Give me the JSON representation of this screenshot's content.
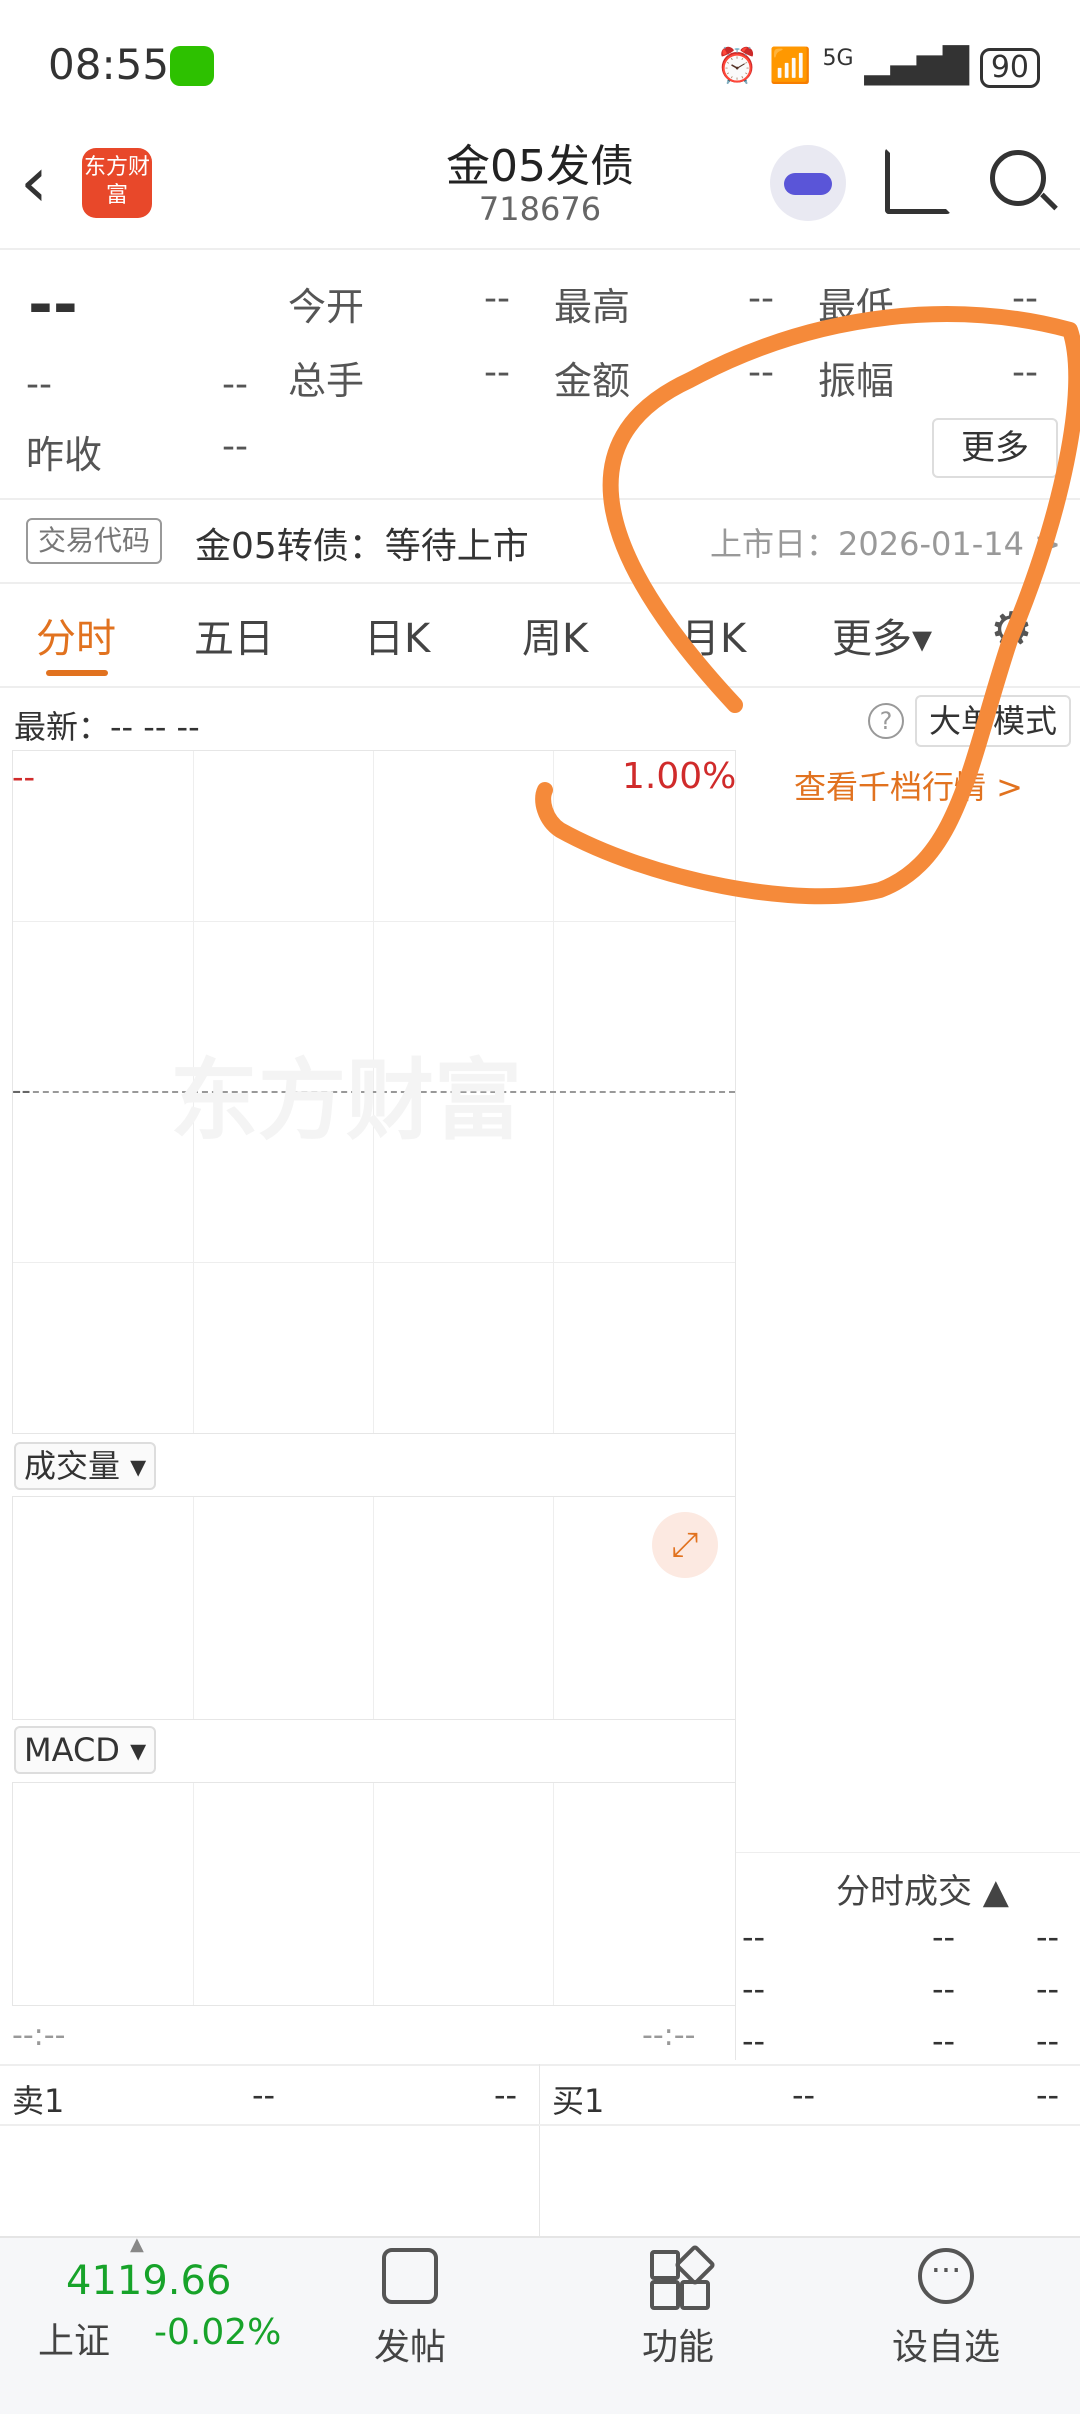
{
  "status_bar": {
    "time": "08:55",
    "network": "5G",
    "battery": "90"
  },
  "header": {
    "title": "金05发债",
    "code": "718676",
    "logo_text": "东方财富"
  },
  "quote": {
    "price": "--",
    "change": "--",
    "change_pct": "--",
    "today_open_label": "今开",
    "today_open": "--",
    "high_label": "最高",
    "high": "--",
    "low_label": "最低",
    "low": "--",
    "volume_label": "总手",
    "volume": "--",
    "amount_label": "金额",
    "amount": "--",
    "amplitude_label": "振幅",
    "amplitude": "--",
    "prev_close_label": "昨收",
    "prev_close": "--",
    "more_button": "更多"
  },
  "listing": {
    "badge": "交易代码",
    "status": "金05转债：等待上市",
    "date": "上市日：2026-01-14 >"
  },
  "tabs": [
    {
      "label": "分时",
      "active": true
    },
    {
      "label": "五日"
    },
    {
      "label": "日K"
    },
    {
      "label": "周K"
    },
    {
      "label": "月K"
    },
    {
      "label": "更多▾"
    }
  ],
  "latest_bar": {
    "text": "最新：--  --  --",
    "big_order_mode": "大单模式"
  },
  "chart": {
    "top_left": "--",
    "top_right_pct": "1.00%",
    "mid_left": "--",
    "depth_link": "查看千档行情 >",
    "watermark": "东方财富",
    "volume_indicator": "成交量 ▾",
    "macd_indicator": "MACD ▾",
    "time_left": "--:--",
    "time_right": "--:--"
  },
  "trades": {
    "title": "分时成交 ▲",
    "rows": [
      [
        "--",
        "--",
        "--"
      ],
      [
        "--",
        "--",
        "--"
      ],
      [
        "--",
        "--",
        "--"
      ]
    ]
  },
  "order_book": {
    "sell_label": "卖1",
    "sell_price": "--",
    "sell_volume": "--",
    "buy_label": "买1",
    "buy_price": "--",
    "buy_volume": "--"
  },
  "bottom_nav": {
    "index_value": "4119.66",
    "index_name": "上证",
    "index_change": "-0.02%",
    "post_label": "发帖",
    "function_label": "功能",
    "watchlist_label": "设自选"
  },
  "colors": {
    "accent": "#e1721f",
    "red": "#d02b2b",
    "green": "#17a32a",
    "annotation": "#f58a3a"
  }
}
